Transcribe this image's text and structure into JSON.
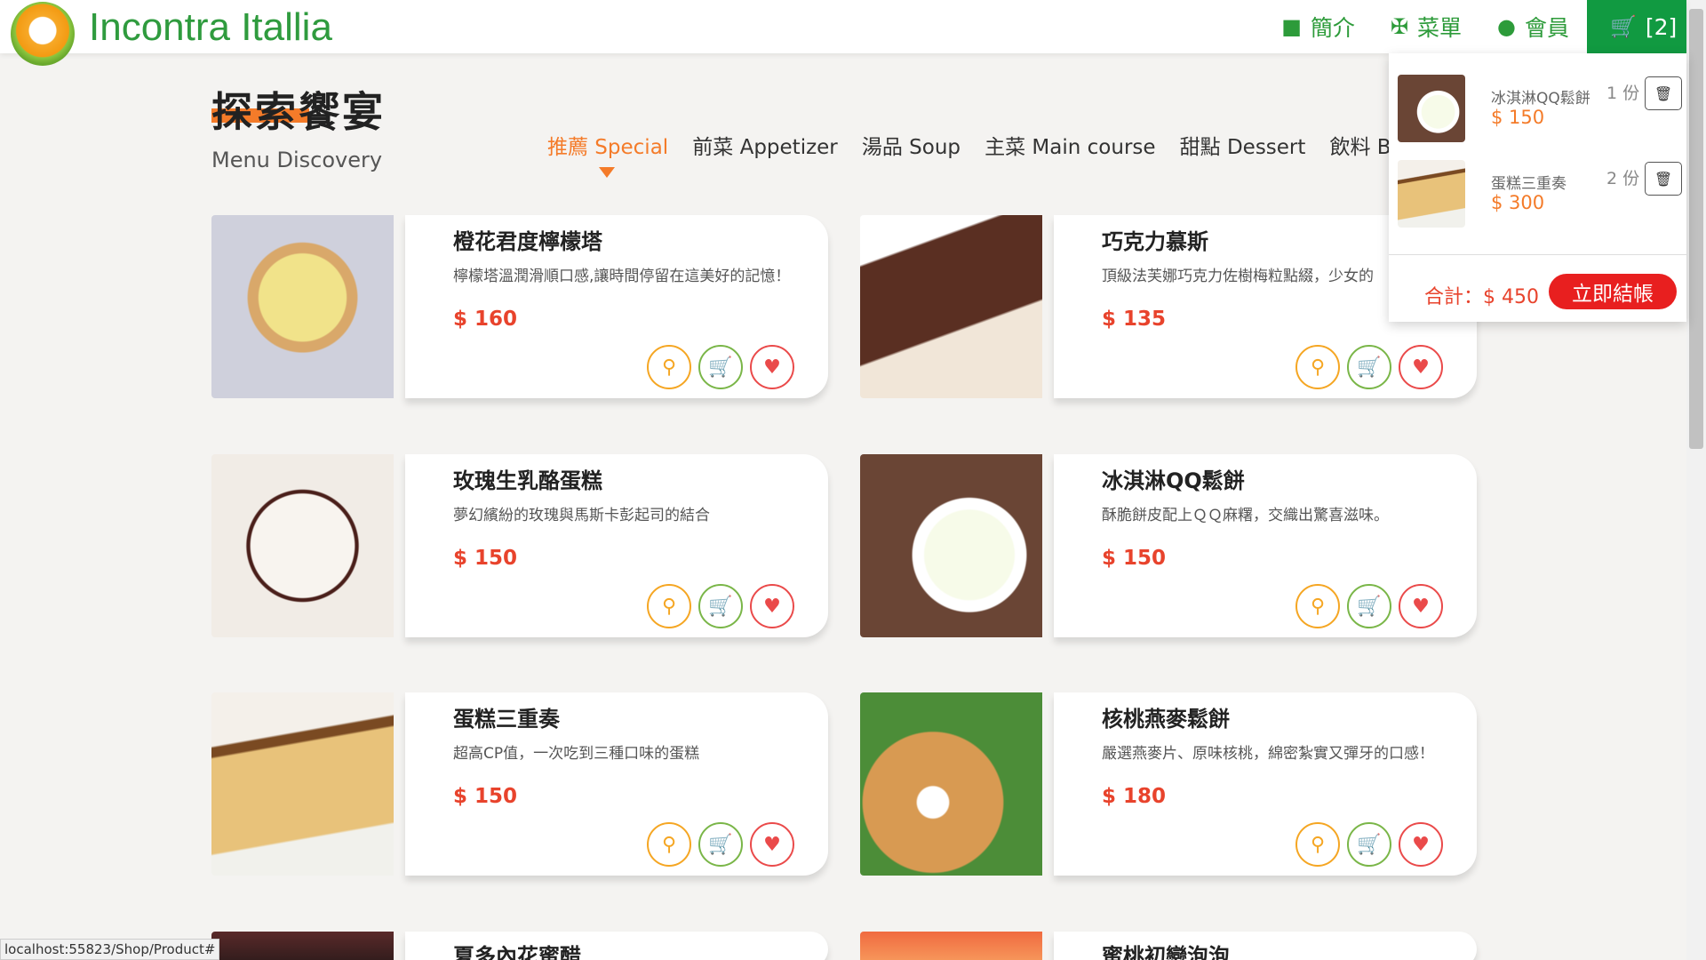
{
  "header": {
    "brand": "Incontra Itallia",
    "nav": [
      {
        "label": "簡介",
        "icon": "store-icon"
      },
      {
        "label": "菜單",
        "icon": "utensils-icon"
      },
      {
        "label": "會員",
        "icon": "user-icon"
      }
    ],
    "cart_label": "[2]"
  },
  "page": {
    "title": "探索饗宴",
    "subtitle": "Menu Discovery"
  },
  "tabs": [
    "推薦 Special",
    "前菜 Appetizer",
    "湯品 Soup",
    "主菜 Main course",
    "甜點 Dessert",
    "飲料 Beverage"
  ],
  "products": [
    {
      "name": "橙花君度檸檬塔",
      "desc": "檸檬塔溫潤滑順口感,讓時間停留在這美好的記憶！",
      "price": "$ 160"
    },
    {
      "name": "巧克力慕斯",
      "desc": "頂級法芙娜巧克力佐樹梅粒點綴，少女的",
      "price": "$ 135"
    },
    {
      "name": "玫瑰生乳酪蛋糕",
      "desc": "夢幻繽紛的玫瑰與馬斯卡彭起司的結合",
      "price": "$ 150"
    },
    {
      "name": "冰淇淋QQ鬆餅",
      "desc": "酥脆餅皮配上ＱＱ麻糬，交織出驚喜滋味。",
      "price": "$ 150"
    },
    {
      "name": "蛋糕三重奏",
      "desc": "超高CP值，一次吃到三種口味的蛋糕",
      "price": "$ 150"
    },
    {
      "name": "核桃燕麥鬆餅",
      "desc": "嚴選燕麥片、原味核桃，綿密紮實又彈牙的口感！",
      "price": "$ 180"
    },
    {
      "name": "夏多內花蜜醋",
      "desc": "",
      "price": ""
    },
    {
      "name": "蜜桃初戀泡泡",
      "desc": "",
      "price": ""
    }
  ],
  "cart": {
    "items": [
      {
        "name": "冰淇淋QQ鬆餅",
        "qty": "1 份",
        "price": "$ 150"
      },
      {
        "name": "蛋糕三重奏",
        "qty": "2 份",
        "price": "$ 300"
      }
    ],
    "total": "合計：$ 450",
    "checkout": "立即結帳"
  },
  "status_url": "localhost:55823/Shop/Product#",
  "icons": {
    "search": "search-icon",
    "add_cart": "cart-plus-icon",
    "favorite": "heart-icon",
    "delete": "trash-icon"
  },
  "colors": {
    "brand_green": "#2d9b3a",
    "cart_green": "#119a41",
    "accent_orange": "#f47b29",
    "price_red": "#e8432c",
    "checkout_red": "#e81f1f"
  }
}
